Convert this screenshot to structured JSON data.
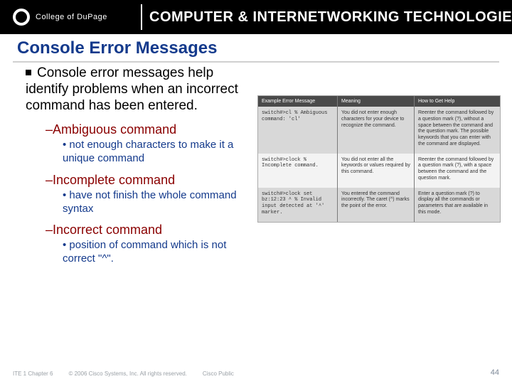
{
  "banner": {
    "college": "College of DuPage",
    "title": "COMPUTER & INTERNETWORKING TECHNOLOGIES"
  },
  "slide_title": "Console Error Messages",
  "main_bullet": "Console error messages help identify problems when an incorrect command has been entered.",
  "items": [
    {
      "name": "–Ambiguous command",
      "detail": "• not enough characters to make it a unique command"
    },
    {
      "name": "–Incomplete command",
      "detail": "• have not finish the whole command syntax"
    },
    {
      "name": "–Incorrect command",
      "detail": "• position of command which is not correct \"^\"."
    }
  ],
  "table": {
    "headers": [
      "Example Error Message",
      "Meaning",
      "How to Get Help"
    ],
    "rows": [
      {
        "code": "switch#>cl\n% Ambiguous command: 'cl'",
        "meaning": "You did not enter enough characters for your device to recognize the command.",
        "help": "Reenter the command followed by a question mark (?), without a space between the command and the question mark.\nThe possible keywords that you can enter with the command are displayed."
      },
      {
        "code": "switch#>clock\n% Incomplete command.",
        "meaning": "You did not enter all the keywords or values required by this command.",
        "help": "Reenter the command followed by a question mark (?), with a space between the command and the question mark."
      },
      {
        "code": "switch#>clock set bz:12:23\n           ^\n% Invalid input detected at '^' marker.",
        "meaning": "You entered the command incorrectly. The caret (^) marks the point of the error.",
        "help": "Enter a question mark (?) to display all the commands or parameters that are available in this mode."
      }
    ]
  },
  "footer": {
    "chapter": "ITE 1 Chapter 6",
    "copyright": "© 2006 Cisco Systems, Inc. All rights reserved.",
    "tag": "Cisco Public",
    "page": "44"
  }
}
